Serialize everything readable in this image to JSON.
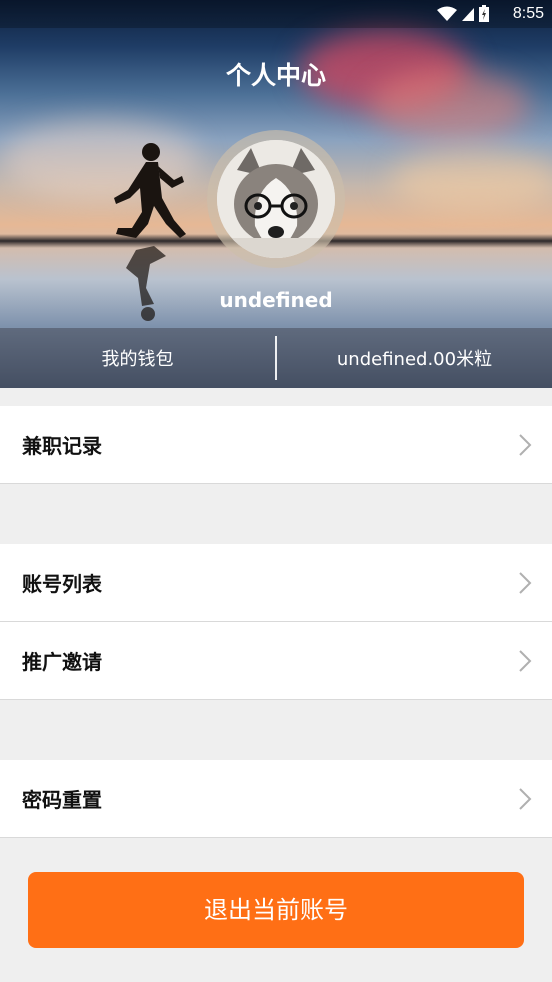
{
  "status_bar": {
    "time": "8:55",
    "icons": [
      "wifi-icon",
      "signal-icon",
      "battery-icon"
    ]
  },
  "header": {
    "title": "个人中心",
    "username": "undefined"
  },
  "wallet": {
    "label": "我的钱包",
    "balance": "undefined.00米粒"
  },
  "menu": {
    "group1": [
      {
        "label": "兼职记录"
      }
    ],
    "group2": [
      {
        "label": "账号列表"
      },
      {
        "label": "推广邀请"
      }
    ],
    "group3": [
      {
        "label": "密码重置"
      }
    ]
  },
  "logout_label": "退出当前账号",
  "colors": {
    "accent": "#ff6f15",
    "background": "#efefef"
  }
}
